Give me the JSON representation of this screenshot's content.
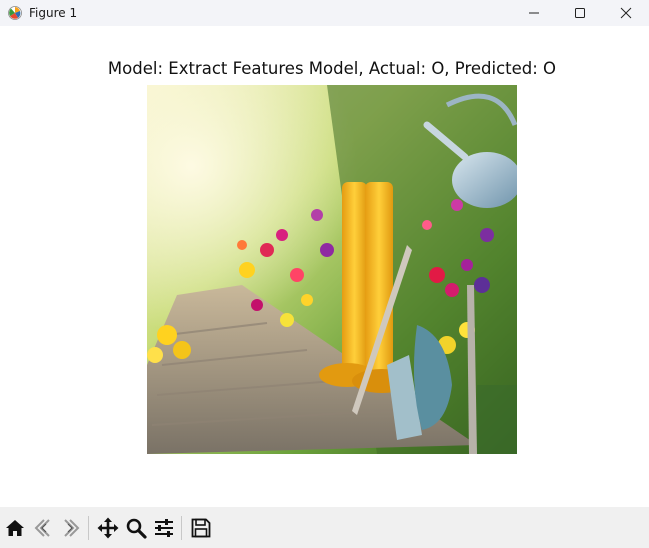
{
  "window": {
    "title": "Figure 1",
    "icons": {
      "app": "matplotlib-icon",
      "minimize": "minimize-icon",
      "maximize": "maximize-icon",
      "close": "close-icon"
    }
  },
  "figure": {
    "title": "Model: Extract Features Model, Actual: O, Predicted: O",
    "image_description_icon": "garden-photo"
  },
  "toolbar": {
    "buttons": [
      "home-icon",
      "back-icon",
      "forward-icon",
      "pan-icon",
      "zoom-icon",
      "configure-subplots-icon",
      "save-icon"
    ],
    "back_enabled": false,
    "forward_enabled": false
  }
}
